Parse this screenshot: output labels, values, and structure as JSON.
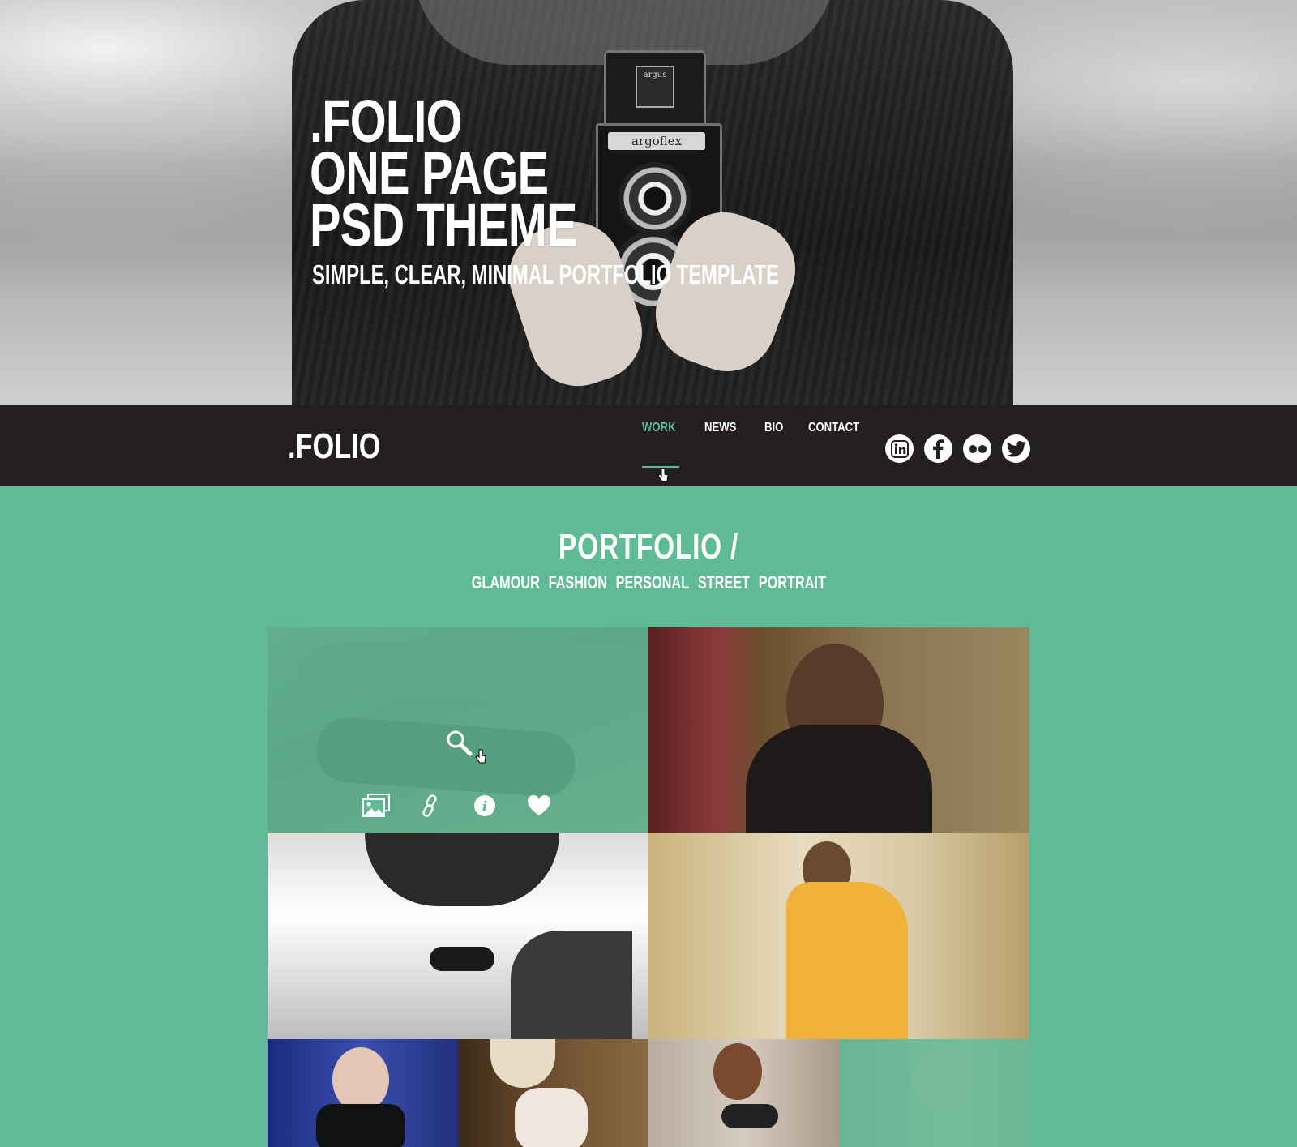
{
  "hero": {
    "title_lines": [
      ".FOLIO",
      "ONE PAGE",
      "PSD THEME"
    ],
    "subtitle": "SIMPLE, CLEAR, MINIMAL PORTFOLIO TEMPLATE",
    "camera_badge": "argus",
    "camera_plate": "argoflex"
  },
  "nav": {
    "logo": ".FOLIO",
    "links": [
      {
        "label": "WORK",
        "active": true
      },
      {
        "label": "NEWS",
        "active": false
      },
      {
        "label": "BIO",
        "active": false
      },
      {
        "label": "CONTACT",
        "active": false
      }
    ],
    "socials": [
      "linkedin-icon",
      "facebook-icon",
      "flickr-icon",
      "twitter-icon"
    ]
  },
  "portfolio": {
    "title": "PORTFOLIO /",
    "filters": [
      "GLAMOUR",
      "FASHION",
      "PERSONAL",
      "STREET",
      "PORTRAIT"
    ],
    "hover_icons": [
      "zoom-icon",
      "gallery-icon",
      "link-icon",
      "info-icon",
      "heart-icon"
    ]
  },
  "colors": {
    "accent": "#5fbb97",
    "nav_bg": "#231f20",
    "text": "#ffffff"
  }
}
